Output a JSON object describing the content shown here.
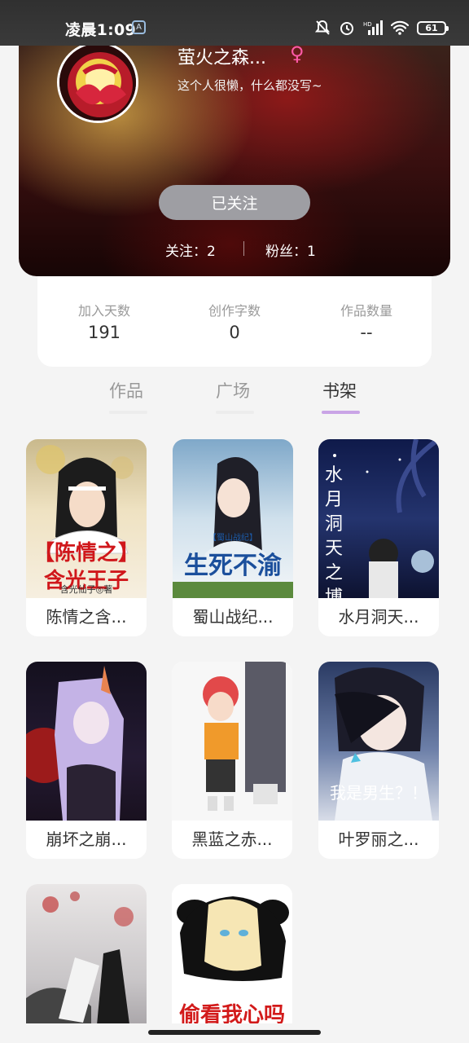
{
  "status_bar": {
    "time": "凌晨1:09",
    "battery": "61",
    "app_badge": "A"
  },
  "profile": {
    "nickname": "萤火之森...",
    "gender_symbol": "♀",
    "bio": "这个人很懒，什么都没写~",
    "follow_button": "已关注",
    "following_label": "关注：2",
    "fans_label": "粉丝：1",
    "colors": {
      "gender": "#ff5aa7",
      "follow_button_bg": "#9e9ea3"
    }
  },
  "stats": [
    {
      "label": "加入天数",
      "value": "191"
    },
    {
      "label": "创作字数",
      "value": "0"
    },
    {
      "label": "作品数量",
      "value": "--"
    }
  ],
  "tabs": [
    {
      "label": "作品",
      "active": false
    },
    {
      "label": "广场",
      "active": false
    },
    {
      "label": "书架",
      "active": true
    }
  ],
  "books": [
    {
      "title": "陈情之含...",
      "cover_text": "【陈情之】含光王子",
      "cover_sub": "含光仙子◎著"
    },
    {
      "title": "蜀山战纪...",
      "cover_text": "生死不渝",
      "cover_sub": "【蜀山战纪】"
    },
    {
      "title": "水月洞天...",
      "cover_text": "水月洞天之博雪",
      "cover_sub": ""
    },
    {
      "title": "崩坏之崩...",
      "cover_text": "",
      "cover_sub": ""
    },
    {
      "title": "黑蓝之赤...",
      "cover_text": "",
      "cover_sub": ""
    },
    {
      "title": "叶罗丽之...",
      "cover_text": "我是男生？！",
      "cover_sub": ""
    },
    {
      "title": "",
      "cover_text": "",
      "cover_sub": ""
    },
    {
      "title": "",
      "cover_text": "偷看我心吗",
      "cover_sub": ""
    }
  ],
  "accent_color": "#c9a4e6"
}
